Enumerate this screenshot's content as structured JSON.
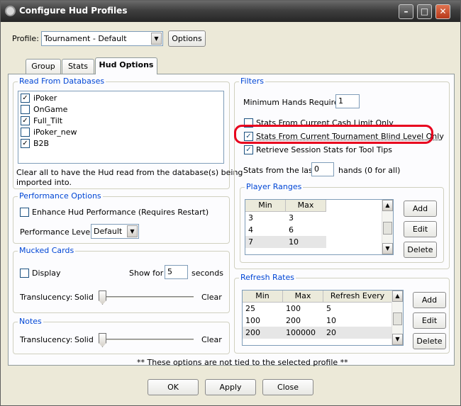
{
  "window": {
    "title": "Configure Hud Profiles"
  },
  "profile": {
    "label": "Profile:",
    "value": "Tournament - Default",
    "options_button": "Options"
  },
  "tabs": [
    {
      "label": "Group"
    },
    {
      "label": "Stats"
    },
    {
      "label": "Hud Options"
    }
  ],
  "read_from_databases": {
    "title": "Read From Databases",
    "items": [
      {
        "label": "iPoker",
        "checked": true
      },
      {
        "label": "OnGame",
        "checked": false
      },
      {
        "label": "Full_Tilt",
        "checked": true
      },
      {
        "label": "iPoker_new",
        "checked": false
      },
      {
        "label": "B2B",
        "checked": true
      }
    ],
    "help_line1": "Clear all to have the Hud read from the database(s) being",
    "help_line2": "imported into."
  },
  "performance": {
    "title": "Performance Options",
    "enhance_label": "Enhance Hud Performance (Requires Restart)",
    "level_label": "Performance Level:",
    "level_value": "Default"
  },
  "mucked_cards": {
    "title": "Mucked Cards",
    "display_label": "Display",
    "show_for_label": "Show for",
    "show_for_value": "5",
    "seconds_label": "seconds",
    "translucency_label": "Translucency:",
    "solid_label": "Solid",
    "clear_label": "Clear"
  },
  "notes": {
    "title": "Notes",
    "translucency_label": "Translucency:",
    "solid_label": "Solid",
    "clear_label": "Clear"
  },
  "filters": {
    "title": "Filters",
    "min_hands_label": "Minimum Hands Required:",
    "min_hands_value": "1",
    "cash_limit_label": "Stats From Current Cash Limit Only",
    "tournament_blind_label": "Stats From Current Tournament Blind Level Only",
    "session_stats_label": "Retrieve Session Stats for Tool Tips",
    "stats_from_last_label": "Stats from the last",
    "stats_from_last_value": "0",
    "hands_hint": "hands (0 for all)"
  },
  "player_ranges": {
    "title": "Player Ranges",
    "columns": [
      "Min",
      "Max"
    ],
    "rows": [
      [
        "3",
        "3"
      ],
      [
        "4",
        "6"
      ],
      [
        "7",
        "10"
      ]
    ],
    "buttons": {
      "add": "Add",
      "edit": "Edit",
      "delete": "Delete"
    }
  },
  "refresh_rates": {
    "title": "Refresh Rates",
    "columns": [
      "Min",
      "Max",
      "Refresh Every"
    ],
    "rows": [
      [
        "25",
        "100",
        "5"
      ],
      [
        "100",
        "200",
        "10"
      ],
      [
        "200",
        "100000",
        "20"
      ]
    ],
    "buttons": {
      "add": "Add",
      "edit": "Edit",
      "delete": "Delete"
    }
  },
  "footnote": "** These options are not tied to the selected profile **",
  "footer_buttons": {
    "ok": "OK",
    "apply": "Apply",
    "close": "Close"
  },
  "colors": {
    "highlight": "#e8001e",
    "group_title": "#0046d5"
  }
}
